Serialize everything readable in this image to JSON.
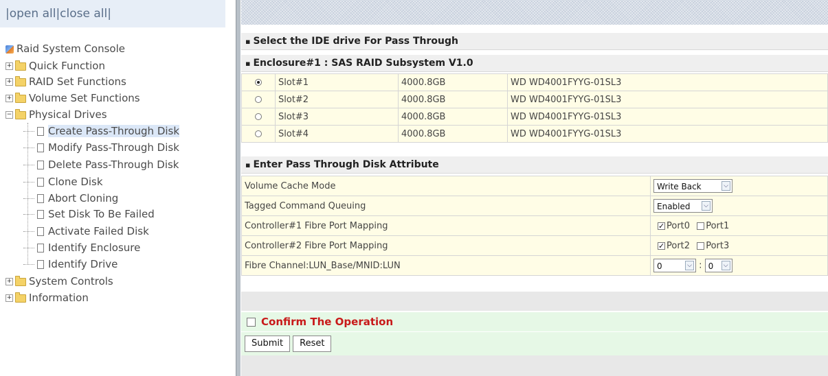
{
  "tree": {
    "open_all": "open all",
    "close_all": "close all",
    "root": "Raid System Console",
    "folders": [
      {
        "label": "Quick Function",
        "expander": "+"
      },
      {
        "label": "RAID Set Functions",
        "expander": "+"
      },
      {
        "label": "Volume Set Functions",
        "expander": "+"
      },
      {
        "label": "Physical Drives",
        "expander": "−"
      }
    ],
    "physical_drive_items": [
      "Create Pass-Through Disk",
      "Modify Pass-Through Disk",
      "Delete Pass-Through Disk",
      "Clone Disk",
      "Abort Cloning",
      "Set Disk To Be Failed",
      "Activate Failed Disk",
      "Identify Enclosure",
      "Identify Drive"
    ],
    "folders_after": [
      {
        "label": "System Controls",
        "expander": "+"
      },
      {
        "label": "Information",
        "expander": "+"
      }
    ]
  },
  "main": {
    "select_header": "Select the IDE drive For Pass Through",
    "enclosure_header": "Enclosure#1 : SAS RAID Subsystem V1.0",
    "drives": [
      {
        "slot": "Slot#1",
        "capacity": "4000.8GB",
        "model": "WD WD4001FYYG-01SL3",
        "selected": true
      },
      {
        "slot": "Slot#2",
        "capacity": "4000.8GB",
        "model": "WD WD4001FYYG-01SL3",
        "selected": false
      },
      {
        "slot": "Slot#3",
        "capacity": "4000.8GB",
        "model": "WD WD4001FYYG-01SL3",
        "selected": false
      },
      {
        "slot": "Slot#4",
        "capacity": "4000.8GB",
        "model": "WD WD4001FYYG-01SL3",
        "selected": false
      }
    ],
    "attr_header": "Enter Pass Through Disk Attribute",
    "attributes": {
      "cache_mode_label": "Volume Cache Mode",
      "cache_mode_value": "Write Back",
      "tcq_label": "Tagged Command Queuing",
      "tcq_value": "Enabled",
      "ctrl1_label": "Controller#1 Fibre Port Mapping",
      "ctrl1_port_a": "Port0",
      "ctrl1_port_b": "Port1",
      "ctrl2_label": "Controller#2 Fibre Port Mapping",
      "ctrl2_port_a": "Port2",
      "ctrl2_port_b": "Port3",
      "lun_label": "Fibre Channel:LUN_Base/MNID:LUN",
      "lun_base_value": "0",
      "lun_separator": ":",
      "lun_value": "0"
    },
    "confirm_label": "Confirm The Operation",
    "submit_label": "Submit",
    "reset_label": "Reset"
  },
  "colors": {
    "confirm_text": "#c81a1a",
    "row_background": "#fffde6",
    "confirm_background": "#e6f8e6"
  }
}
